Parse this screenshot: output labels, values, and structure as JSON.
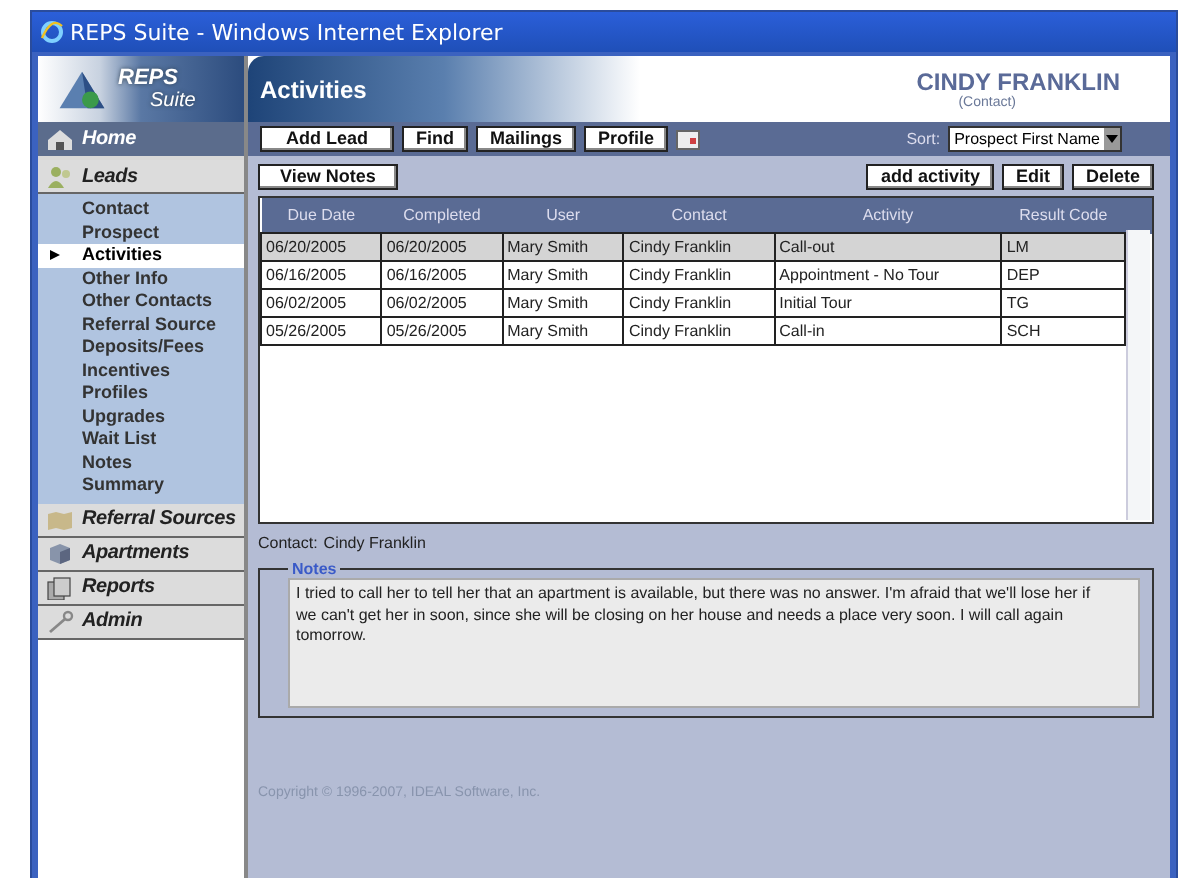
{
  "window": {
    "title": "REPS Suite - Windows Internet Explorer"
  },
  "logo": {
    "line1": "REPS",
    "line2": "Suite"
  },
  "sidebar": {
    "sections": [
      {
        "label": "Home",
        "kind": "home"
      },
      {
        "label": "Leads",
        "kind": "people",
        "items": [
          {
            "label": "Contact",
            "selected": false
          },
          {
            "label": "Prospect",
            "selected": false
          },
          {
            "label": "Activities",
            "selected": true
          },
          {
            "label": "Other Info",
            "selected": false
          },
          {
            "label": "Other Contacts",
            "selected": false
          },
          {
            "label": "Referral Source",
            "selected": false
          },
          {
            "label": "Deposits/Fees",
            "selected": false
          },
          {
            "label": "Incentives",
            "selected": false
          },
          {
            "label": "Profiles",
            "selected": false
          },
          {
            "label": "Upgrades",
            "selected": false
          },
          {
            "label": "Wait List",
            "selected": false
          },
          {
            "label": "Notes",
            "selected": false
          },
          {
            "label": "Summary",
            "selected": false
          }
        ]
      },
      {
        "label": "Referral Sources",
        "kind": "map"
      },
      {
        "label": "Apartments",
        "kind": "cube"
      },
      {
        "label": "Reports",
        "kind": "pages"
      },
      {
        "label": "Admin",
        "kind": "key"
      }
    ]
  },
  "header": {
    "title": "Activities",
    "person": "CINDY FRANKLIN",
    "role": "(Contact)"
  },
  "toolbar": {
    "buttons": [
      "Add Lead",
      "Find",
      "Mailings",
      "Profile"
    ],
    "sort_label": "Sort:",
    "sort_value": "Prospect First Name"
  },
  "actions": {
    "left": "View Notes",
    "right": [
      "add activity",
      "Edit",
      "Delete"
    ]
  },
  "table": {
    "columns": [
      "Due Date",
      "Completed",
      "User",
      "Contact",
      "Activity",
      "Result Code"
    ],
    "rows": [
      {
        "selected": true,
        "cells": [
          "06/20/2005",
          "06/20/2005",
          "Mary Smith",
          "Cindy Franklin",
          "Call-out",
          "LM"
        ]
      },
      {
        "selected": false,
        "cells": [
          "06/16/2005",
          "06/16/2005",
          "Mary Smith",
          "Cindy Franklin",
          "Appointment - No Tour",
          "DEP"
        ]
      },
      {
        "selected": false,
        "cells": [
          "06/02/2005",
          "06/02/2005",
          "Mary Smith",
          "Cindy Franklin",
          "Initial Tour",
          "TG"
        ]
      },
      {
        "selected": false,
        "cells": [
          "05/26/2005",
          "05/26/2005",
          "Mary Smith",
          "Cindy Franklin",
          "Call-in",
          "SCH"
        ]
      }
    ]
  },
  "contact": {
    "label": "Contact:",
    "value": "Cindy Franklin"
  },
  "notes": {
    "legend": "Notes",
    "text": "I tried to call her to tell her that an apartment is available, but there was no answer.  I'm afraid that we'll lose her if we can't get her in soon, since she will be closing on her house and needs a place very soon.  I will call again tomorrow."
  },
  "copyright": "Copyright © 1996-2007, IDEAL Software, Inc."
}
